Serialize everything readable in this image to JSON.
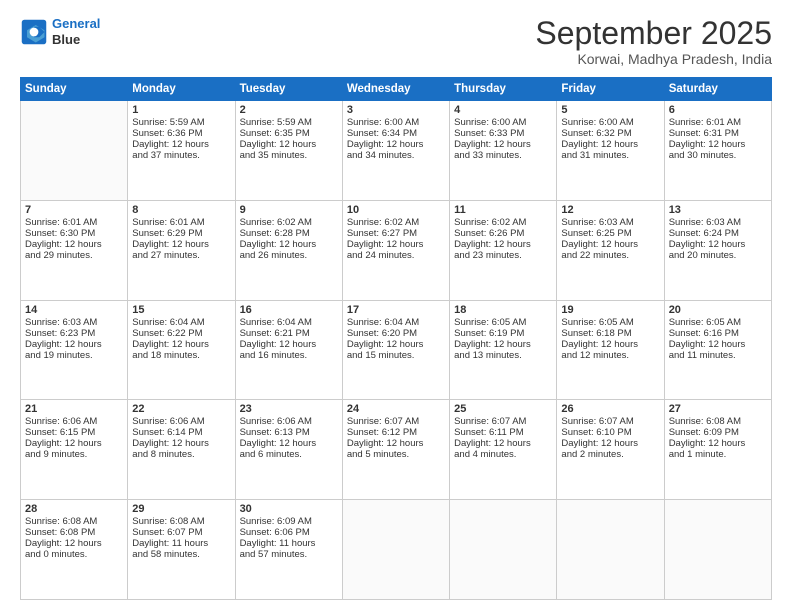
{
  "logo": {
    "line1": "General",
    "line2": "Blue"
  },
  "header": {
    "month": "September 2025",
    "location": "Korwai, Madhya Pradesh, India"
  },
  "days_of_week": [
    "Sunday",
    "Monday",
    "Tuesday",
    "Wednesday",
    "Thursday",
    "Friday",
    "Saturday"
  ],
  "weeks": [
    [
      {
        "day": "",
        "info": ""
      },
      {
        "day": "1",
        "info": "Sunrise: 5:59 AM\nSunset: 6:36 PM\nDaylight: 12 hours\nand 37 minutes."
      },
      {
        "day": "2",
        "info": "Sunrise: 5:59 AM\nSunset: 6:35 PM\nDaylight: 12 hours\nand 35 minutes."
      },
      {
        "day": "3",
        "info": "Sunrise: 6:00 AM\nSunset: 6:34 PM\nDaylight: 12 hours\nand 34 minutes."
      },
      {
        "day": "4",
        "info": "Sunrise: 6:00 AM\nSunset: 6:33 PM\nDaylight: 12 hours\nand 33 minutes."
      },
      {
        "day": "5",
        "info": "Sunrise: 6:00 AM\nSunset: 6:32 PM\nDaylight: 12 hours\nand 31 minutes."
      },
      {
        "day": "6",
        "info": "Sunrise: 6:01 AM\nSunset: 6:31 PM\nDaylight: 12 hours\nand 30 minutes."
      }
    ],
    [
      {
        "day": "7",
        "info": "Sunrise: 6:01 AM\nSunset: 6:30 PM\nDaylight: 12 hours\nand 29 minutes."
      },
      {
        "day": "8",
        "info": "Sunrise: 6:01 AM\nSunset: 6:29 PM\nDaylight: 12 hours\nand 27 minutes."
      },
      {
        "day": "9",
        "info": "Sunrise: 6:02 AM\nSunset: 6:28 PM\nDaylight: 12 hours\nand 26 minutes."
      },
      {
        "day": "10",
        "info": "Sunrise: 6:02 AM\nSunset: 6:27 PM\nDaylight: 12 hours\nand 24 minutes."
      },
      {
        "day": "11",
        "info": "Sunrise: 6:02 AM\nSunset: 6:26 PM\nDaylight: 12 hours\nand 23 minutes."
      },
      {
        "day": "12",
        "info": "Sunrise: 6:03 AM\nSunset: 6:25 PM\nDaylight: 12 hours\nand 22 minutes."
      },
      {
        "day": "13",
        "info": "Sunrise: 6:03 AM\nSunset: 6:24 PM\nDaylight: 12 hours\nand 20 minutes."
      }
    ],
    [
      {
        "day": "14",
        "info": "Sunrise: 6:03 AM\nSunset: 6:23 PM\nDaylight: 12 hours\nand 19 minutes."
      },
      {
        "day": "15",
        "info": "Sunrise: 6:04 AM\nSunset: 6:22 PM\nDaylight: 12 hours\nand 18 minutes."
      },
      {
        "day": "16",
        "info": "Sunrise: 6:04 AM\nSunset: 6:21 PM\nDaylight: 12 hours\nand 16 minutes."
      },
      {
        "day": "17",
        "info": "Sunrise: 6:04 AM\nSunset: 6:20 PM\nDaylight: 12 hours\nand 15 minutes."
      },
      {
        "day": "18",
        "info": "Sunrise: 6:05 AM\nSunset: 6:19 PM\nDaylight: 12 hours\nand 13 minutes."
      },
      {
        "day": "19",
        "info": "Sunrise: 6:05 AM\nSunset: 6:18 PM\nDaylight: 12 hours\nand 12 minutes."
      },
      {
        "day": "20",
        "info": "Sunrise: 6:05 AM\nSunset: 6:16 PM\nDaylight: 12 hours\nand 11 minutes."
      }
    ],
    [
      {
        "day": "21",
        "info": "Sunrise: 6:06 AM\nSunset: 6:15 PM\nDaylight: 12 hours\nand 9 minutes."
      },
      {
        "day": "22",
        "info": "Sunrise: 6:06 AM\nSunset: 6:14 PM\nDaylight: 12 hours\nand 8 minutes."
      },
      {
        "day": "23",
        "info": "Sunrise: 6:06 AM\nSunset: 6:13 PM\nDaylight: 12 hours\nand 6 minutes."
      },
      {
        "day": "24",
        "info": "Sunrise: 6:07 AM\nSunset: 6:12 PM\nDaylight: 12 hours\nand 5 minutes."
      },
      {
        "day": "25",
        "info": "Sunrise: 6:07 AM\nSunset: 6:11 PM\nDaylight: 12 hours\nand 4 minutes."
      },
      {
        "day": "26",
        "info": "Sunrise: 6:07 AM\nSunset: 6:10 PM\nDaylight: 12 hours\nand 2 minutes."
      },
      {
        "day": "27",
        "info": "Sunrise: 6:08 AM\nSunset: 6:09 PM\nDaylight: 12 hours\nand 1 minute."
      }
    ],
    [
      {
        "day": "28",
        "info": "Sunrise: 6:08 AM\nSunset: 6:08 PM\nDaylight: 12 hours\nand 0 minutes."
      },
      {
        "day": "29",
        "info": "Sunrise: 6:08 AM\nSunset: 6:07 PM\nDaylight: 11 hours\nand 58 minutes."
      },
      {
        "day": "30",
        "info": "Sunrise: 6:09 AM\nSunset: 6:06 PM\nDaylight: 11 hours\nand 57 minutes."
      },
      {
        "day": "",
        "info": ""
      },
      {
        "day": "",
        "info": ""
      },
      {
        "day": "",
        "info": ""
      },
      {
        "day": "",
        "info": ""
      }
    ]
  ]
}
